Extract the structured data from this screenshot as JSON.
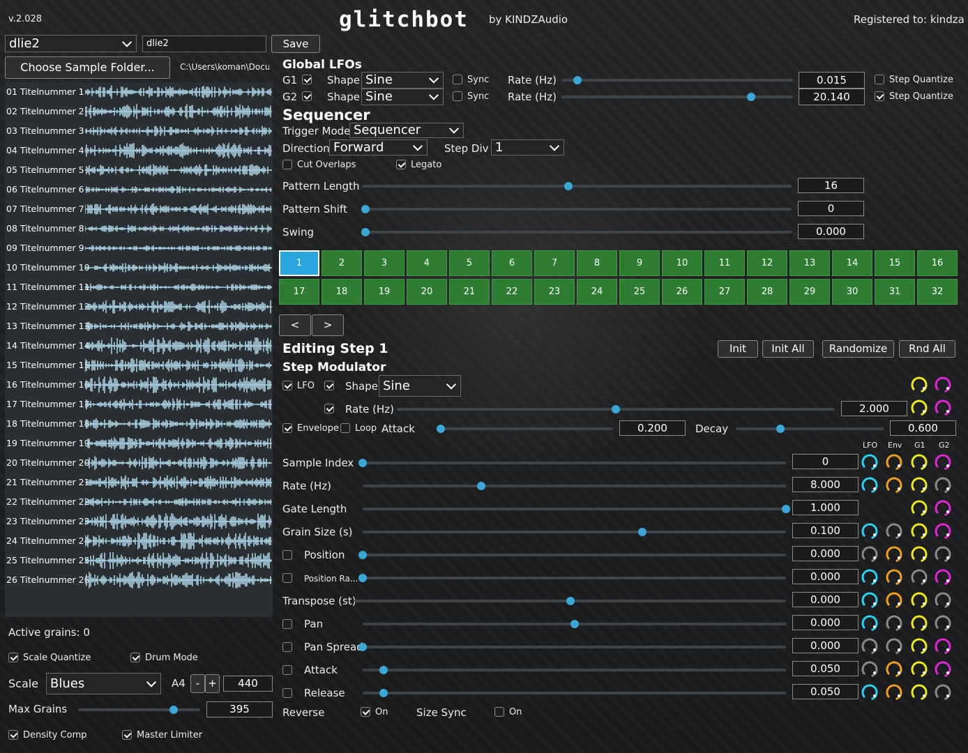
{
  "header": {
    "version": "v.2.028",
    "logo": "glitchbot",
    "by": "by KINDZAudio",
    "registered": "Registered to: kindza"
  },
  "preset": {
    "selected": "dlie2",
    "name_value": "dlie2",
    "save_label": "Save",
    "choose_folder_label": "Choose Sample Folder...",
    "folder_path": "C:\\Users\\koman\\Docu..."
  },
  "samples": [
    "01 Titelnummer 1",
    "02 Titelnummer 2",
    "03 Titelnummer 3",
    "04 Titelnummer 4",
    "05 Titelnummer 5",
    "06 Titelnummer 6",
    "07 Titelnummer 7",
    "08 Titelnummer 8",
    "09 Titelnummer 9",
    "10 Titelnummer 10",
    "11 Titelnummer 11",
    "12 Titelnummer 12",
    "13 Titelnummer 13",
    "14 Titelnummer 14",
    "15 Titelnummer 15",
    "16 Titelnummer 16",
    "17 Titelnummer 17",
    "18 Titelnummer 18",
    "19 Titelnummer 19",
    "20 Titelnummer 20",
    "21 Titelnummer 21",
    "22 Titelnummer 22",
    "23 Titelnummer 23",
    "24 Titelnummer 24",
    "25 Titelnummer 25",
    "26 Titelnummer 26"
  ],
  "left": {
    "active_grains": "Active grains: 0",
    "scale_quantize": {
      "label": "Scale Quantize",
      "checked": true
    },
    "drum_mode": {
      "label": "Drum Mode",
      "checked": true
    },
    "scale_label": "Scale",
    "scale_value": "Blues",
    "a4_label": "A4",
    "minus": "-",
    "plus": "+",
    "a4_value": "440",
    "max_grains_label": "Max Grains",
    "max_grains_value": "395",
    "max_grains_pos": 0.78,
    "density_comp": {
      "label": "Density Comp",
      "checked": true
    },
    "master_limiter": {
      "label": "Master Limiter",
      "checked": true
    }
  },
  "global_lfos": {
    "title": "Global LFOs",
    "rows": [
      {
        "id": "G1",
        "enabled": true,
        "shape_label": "Shape",
        "shape": "Sine",
        "sync_label": "Sync",
        "sync": false,
        "rate_label": "Rate (Hz)",
        "value": "0.015",
        "pos": 0.07,
        "sq_label": "Step Quantize",
        "sq": false
      },
      {
        "id": "G2",
        "enabled": true,
        "shape_label": "Shape",
        "shape": "Sine",
        "sync_label": "Sync",
        "sync": false,
        "rate_label": "Rate (Hz)",
        "value": "20.140",
        "pos": 0.82,
        "sq_label": "Step Quantize",
        "sq": true
      }
    ]
  },
  "sequencer": {
    "title": "Sequencer",
    "trigger_mode_label": "Trigger Mode",
    "trigger_mode": "Sequencer",
    "direction_label": "Direction",
    "direction": "Forward",
    "step_div_label": "Step Div",
    "step_div": "1",
    "cut_overlaps": {
      "label": "Cut Overlaps",
      "checked": false
    },
    "legato": {
      "label": "Legato",
      "checked": true
    },
    "sliders": [
      {
        "label": "Pattern Length",
        "value": "16",
        "pos": 0.48
      },
      {
        "label": "Pattern Shift",
        "value": "0",
        "pos": 0.0
      },
      {
        "label": "Swing",
        "value": "0.000",
        "pos": 0.0
      }
    ],
    "steps": [
      "1",
      "2",
      "3",
      "4",
      "5",
      "6",
      "7",
      "8",
      "9",
      "10",
      "11",
      "12",
      "13",
      "14",
      "15",
      "16",
      "17",
      "18",
      "19",
      "20",
      "21",
      "22",
      "23",
      "24",
      "25",
      "26",
      "27",
      "28",
      "29",
      "30",
      "31",
      "32"
    ],
    "active_step": 1,
    "prev": "<",
    "next": ">"
  },
  "editing": {
    "title": "Editing Step 1",
    "buttons": [
      "Init",
      "Init All",
      "Randomize",
      "Rnd All"
    ],
    "step_mod_title": "Step Modulator",
    "lfo": {
      "label": "LFO",
      "checked": true
    },
    "shape_cb": true,
    "shape_label": "Shape",
    "shape": "Sine",
    "rate_cb": true,
    "rate_label": "Rate (Hz)",
    "rate_value": "2.000",
    "rate_pos": 0.5,
    "envelope": {
      "label": "Envelope",
      "checked": true
    },
    "loop": {
      "label": "Loop",
      "checked": false
    },
    "attack_label": "Attack",
    "attack_value": "0.200",
    "attack_pos": 0.02,
    "decay_label": "Decay",
    "decay_value": "0.600",
    "decay_pos": 0.3,
    "mod_headers": [
      "LFO",
      "Env",
      "G1",
      "G2"
    ]
  },
  "params": [
    {
      "label": "Sample Index",
      "cb": null,
      "value": "0",
      "pos": 0.0,
      "mods": [
        "cyan",
        "orange",
        "yellow",
        "magenta"
      ]
    },
    {
      "label": "Rate (Hz)",
      "cb": null,
      "value": "8.000",
      "pos": 0.28,
      "mods": [
        "cyan",
        "orange",
        "yellow",
        "gray"
      ]
    },
    {
      "label": "Gate Length",
      "cb": null,
      "value": "1.000",
      "pos": 1.0,
      "mods": [
        null,
        null,
        "yellow",
        "magenta"
      ]
    },
    {
      "label": "Grain Size (s)",
      "cb": null,
      "value": "0.100",
      "pos": 0.66,
      "mods": [
        "cyan",
        "gray",
        "yellow",
        "magenta"
      ]
    },
    {
      "label": "Position",
      "cb": false,
      "value": "0.000",
      "pos": 0.0,
      "mods": [
        "gray",
        "orange",
        "yellow",
        "gray"
      ]
    },
    {
      "label": "Position Ra...",
      "cb": false,
      "value": "0.000",
      "pos": 0.0,
      "mods": [
        "cyan",
        "orange",
        "gray",
        "magenta"
      ]
    },
    {
      "label": "Transpose (st)",
      "cb": null,
      "value": "0.000",
      "pos": 0.5,
      "mods": [
        "cyan",
        "orange",
        "yellow",
        "gray"
      ]
    },
    {
      "label": "Pan",
      "cb": false,
      "value": "0.000",
      "pos": 0.5,
      "mods": [
        "cyan",
        "gray",
        "yellow",
        "gray"
      ]
    },
    {
      "label": "Pan Spread",
      "cb": false,
      "value": "0.000",
      "pos": 0.0,
      "mods": [
        "gray",
        "gray",
        "yellow",
        "magenta"
      ]
    },
    {
      "label": "Attack",
      "cb": false,
      "value": "0.050",
      "pos": 0.05,
      "mods": [
        "gray",
        "orange",
        "yellow",
        "magenta"
      ]
    },
    {
      "label": "Release",
      "cb": false,
      "value": "0.050",
      "pos": 0.05,
      "mods": [
        "cyan",
        "orange",
        "yellow",
        "gray"
      ]
    }
  ],
  "bottom": {
    "reverse_label": "Reverse",
    "reverse": {
      "label": "On",
      "checked": true
    },
    "size_sync_label": "Size Sync",
    "size_sync": {
      "label": "On",
      "checked": false
    }
  },
  "colors": {
    "accent": "#3aa7d7",
    "step_green": "#2f7d32",
    "step_active": "#2aa6df",
    "cyan": "#29d4f0",
    "orange": "#f0a020",
    "yellow": "#f2ea1a",
    "magenta": "#e624d8",
    "gray": "#8a8a8a"
  }
}
